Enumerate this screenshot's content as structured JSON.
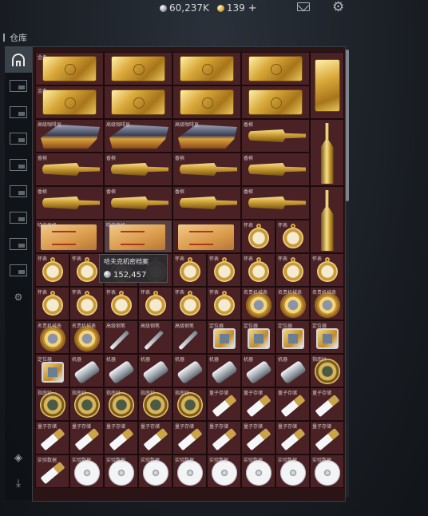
{
  "topbar": {
    "silver_amount": "60,237K",
    "gold_amount": "139",
    "add_label": "+"
  },
  "title": "仓库",
  "tooltip": {
    "name": "哈夫克机密档案",
    "price": "152,457"
  },
  "grid_rows": [
    [
      {
        "label": "金条",
        "art": "gold-bar",
        "span": "wide2"
      },
      {
        "label": "",
        "art": "gold-bar",
        "span": "wide2"
      },
      {
        "label": "",
        "art": "gold-bar",
        "span": "wide2"
      },
      {
        "label": "",
        "art": "gold-bar",
        "span": "wide2"
      },
      {
        "label": "",
        "art": "gold-bar-v",
        "span": "tall2"
      }
    ],
    [
      {
        "label": "金条",
        "art": "gold-bar",
        "span": "wide2"
      },
      {
        "label": "",
        "art": "gold-bar",
        "span": "wide2"
      },
      {
        "label": "",
        "art": "gold-bar",
        "span": "wide2"
      },
      {
        "label": "",
        "art": "gold-bar",
        "span": "wide2"
      }
    ],
    [
      {
        "label": "高级咖啡豆",
        "art": "figurine",
        "span": "wide2"
      },
      {
        "label": "高级咖啡豆",
        "art": "figurine",
        "span": "wide2"
      },
      {
        "label": "高级咖啡豆",
        "art": "figurine",
        "span": "wide2"
      },
      {
        "label": "香槟",
        "art": "bottle-h",
        "span": "wide2"
      },
      {
        "label": "",
        "art": "bottle-v",
        "span": "tall2"
      }
    ],
    [
      {
        "label": "香槟",
        "art": "bottle-h",
        "span": "wide2"
      },
      {
        "label": "香槟",
        "art": "bottle-h",
        "span": "wide2"
      },
      {
        "label": "香槟",
        "art": "bottle-h",
        "span": "wide2"
      },
      {
        "label": "香槟",
        "art": "bottle-h",
        "span": "wide2"
      }
    ],
    [
      {
        "label": "香槟",
        "art": "bottle-h",
        "span": "wide2"
      },
      {
        "label": "香槟",
        "art": "bottle-h",
        "span": "wide2"
      },
      {
        "label": "香槟",
        "art": "bottle-h",
        "span": "wide2"
      },
      {
        "label": "香槟",
        "art": "bottle-h",
        "span": "wide2"
      },
      {
        "label": "",
        "art": "bottle-v",
        "span": "tall2"
      }
    ],
    [
      {
        "label": "哈夫克机",
        "art": "folder",
        "span": "wide2"
      },
      {
        "label": "哈夫克机",
        "art": "folder",
        "span": "wide2",
        "hl": true
      },
      {
        "label": "",
        "art": "folder",
        "span": "wide2"
      },
      {
        "label": "怀表",
        "art": "pocketwatch",
        "span": ""
      },
      {
        "label": "怀表",
        "art": "pocketwatch",
        "span": ""
      }
    ],
    [
      {
        "label": "怀表",
        "art": "pocketwatch"
      },
      {
        "label": "怀表",
        "art": "pocketwatch"
      },
      {
        "label": "怀表",
        "art": "pocketwatch"
      },
      {
        "label": "怀表",
        "art": "pocketwatch"
      },
      {
        "label": "怀表",
        "art": "pocketwatch"
      },
      {
        "label": "怀表",
        "art": "pocketwatch"
      },
      {
        "label": "怀表",
        "art": "pocketwatch"
      },
      {
        "label": "怀表",
        "art": "pocketwatch"
      },
      {
        "label": "怀表",
        "art": "pocketwatch"
      }
    ],
    [
      {
        "label": "怀表",
        "art": "pocketwatch"
      },
      {
        "label": "怀表",
        "art": "pocketwatch"
      },
      {
        "label": "怀表",
        "art": "pocketwatch"
      },
      {
        "label": "怀表",
        "art": "pocketwatch"
      },
      {
        "label": "怀表",
        "art": "pocketwatch"
      },
      {
        "label": "怀表",
        "art": "pocketwatch"
      },
      {
        "label": "名贵机械表",
        "art": "wristwatch"
      },
      {
        "label": "名贵机械表",
        "art": "wristwatch"
      },
      {
        "label": "名贵机械表",
        "art": "wristwatch"
      }
    ],
    [
      {
        "label": "名贵机械表",
        "art": "wristwatch"
      },
      {
        "label": "名贵机械表",
        "art": "wristwatch"
      },
      {
        "label": "高级钢笔",
        "art": "pen"
      },
      {
        "label": "高级钢笔",
        "art": "pen"
      },
      {
        "label": "高级钢笔",
        "art": "pen"
      },
      {
        "label": "定位器",
        "art": "device"
      },
      {
        "label": "定位器",
        "art": "device"
      },
      {
        "label": "定位器",
        "art": "device"
      },
      {
        "label": "定位器",
        "art": "device"
      }
    ],
    [
      {
        "label": "定位器",
        "art": "device"
      },
      {
        "label": "机器",
        "art": "cylinder"
      },
      {
        "label": "机器",
        "art": "cylinder"
      },
      {
        "label": "机器",
        "art": "cylinder"
      },
      {
        "label": "机器",
        "art": "cylinder"
      },
      {
        "label": "机器",
        "art": "cylinder"
      },
      {
        "label": "机器",
        "art": "cylinder"
      },
      {
        "label": "机器",
        "art": "cylinder"
      },
      {
        "label": "指南针",
        "art": "compass"
      }
    ],
    [
      {
        "label": "指南针",
        "art": "compass"
      },
      {
        "label": "指南针",
        "art": "compass"
      },
      {
        "label": "指南针",
        "art": "compass"
      },
      {
        "label": "指南针",
        "art": "compass"
      },
      {
        "label": "指南针",
        "art": "compass"
      },
      {
        "label": "量子存储",
        "art": "usb"
      },
      {
        "label": "量子存储",
        "art": "usb"
      },
      {
        "label": "量子存储",
        "art": "usb"
      },
      {
        "label": "量子存储",
        "art": "usb"
      }
    ],
    [
      {
        "label": "量子存储",
        "art": "usb"
      },
      {
        "label": "量子存储",
        "art": "usb"
      },
      {
        "label": "量子存储",
        "art": "usb"
      },
      {
        "label": "量子存储",
        "art": "usb"
      },
      {
        "label": "量子存储",
        "art": "usb"
      },
      {
        "label": "量子存储",
        "art": "usb"
      },
      {
        "label": "量子存储",
        "art": "usb"
      },
      {
        "label": "量子存储",
        "art": "usb"
      },
      {
        "label": "量子存储",
        "art": "usb"
      }
    ],
    [
      {
        "label": "实验数据",
        "art": "usb"
      },
      {
        "label": "实验数据",
        "art": "disk"
      },
      {
        "label": "实验数据",
        "art": "disk"
      },
      {
        "label": "实验数据",
        "art": "disk"
      },
      {
        "label": "实验数据",
        "art": "disk"
      },
      {
        "label": "实验数据",
        "art": "disk"
      },
      {
        "label": "实验数据",
        "art": "disk"
      },
      {
        "label": "实验数据",
        "art": "disk"
      },
      {
        "label": "实验数据",
        "art": "disk"
      }
    ]
  ]
}
